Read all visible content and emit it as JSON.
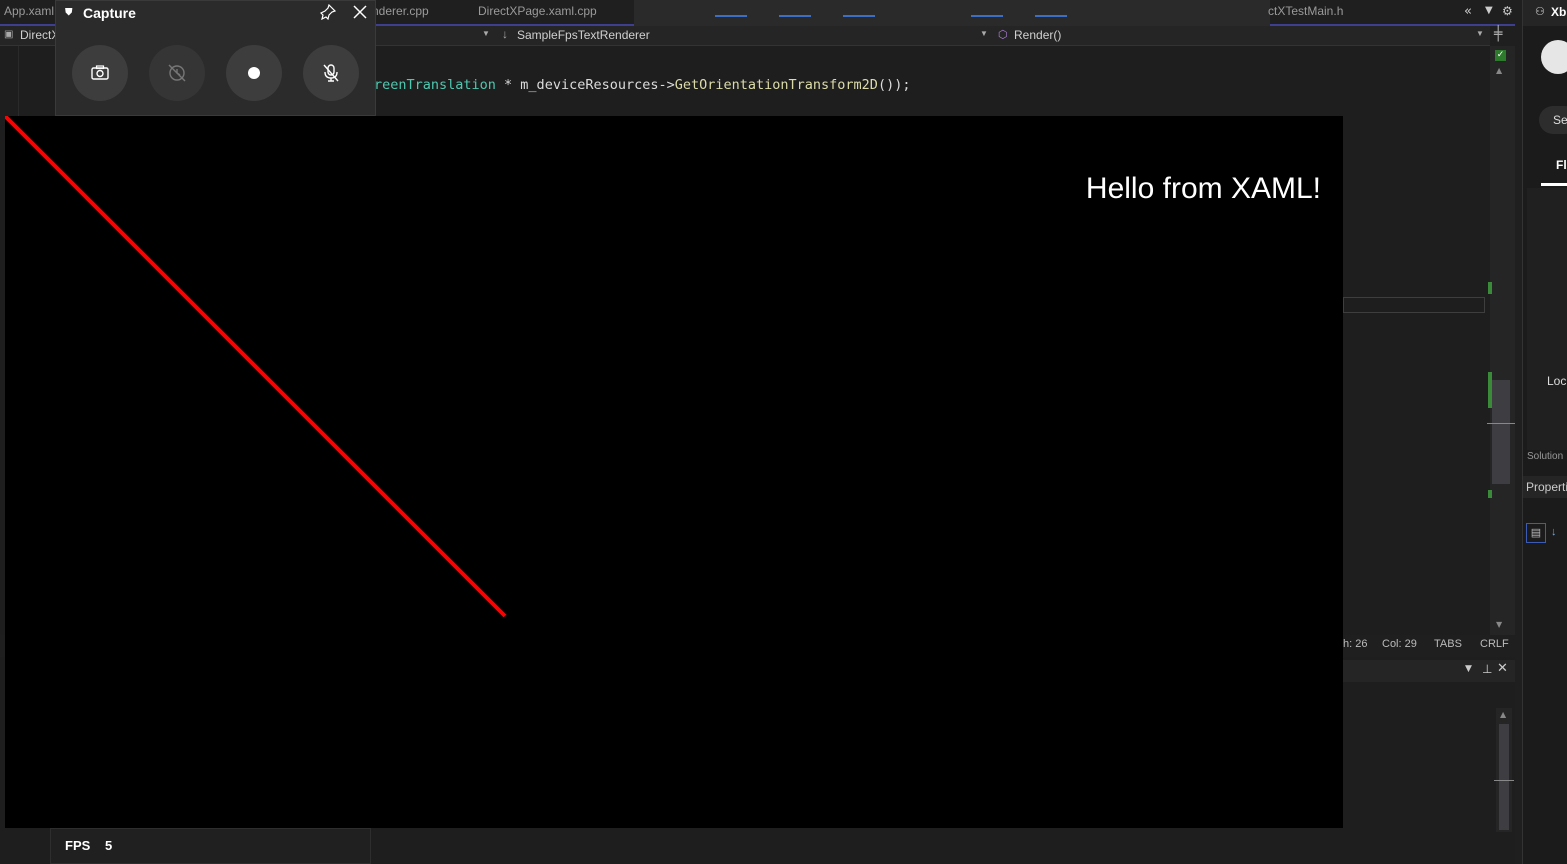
{
  "ide": {
    "tabs": [
      "App.xaml",
      "nderer.cpp",
      "DirectXPage.xaml.cpp",
      "ctXTestMain.h"
    ],
    "nav": {
      "project": "DirectX",
      "class": "SampleFpsTextRenderer",
      "member": "Render()"
    },
    "code": {
      "visible_line_start": "reenTranslation",
      "visible_line_mid": " * m_deviceResources->",
      "visible_line_method": "GetOrientationTransform2D",
      "visible_line_end": "());"
    },
    "status": {
      "ln": "h: 26",
      "col": "Col: 29",
      "indent": "TABS",
      "eol": "CRLF"
    },
    "right_panel": {
      "header": "Xb",
      "search": "Se",
      "tab": "Fl",
      "local": "Loc",
      "solution": "Solution",
      "properties": "Properti"
    }
  },
  "capture": {
    "title": "Capture",
    "buttons": [
      "screenshot",
      "record-last",
      "record",
      "mic-off"
    ]
  },
  "app": {
    "hello_text": "Hello from XAML!",
    "line_color": "#ff0000",
    "fps_label": "FPS",
    "fps_value": "5"
  }
}
